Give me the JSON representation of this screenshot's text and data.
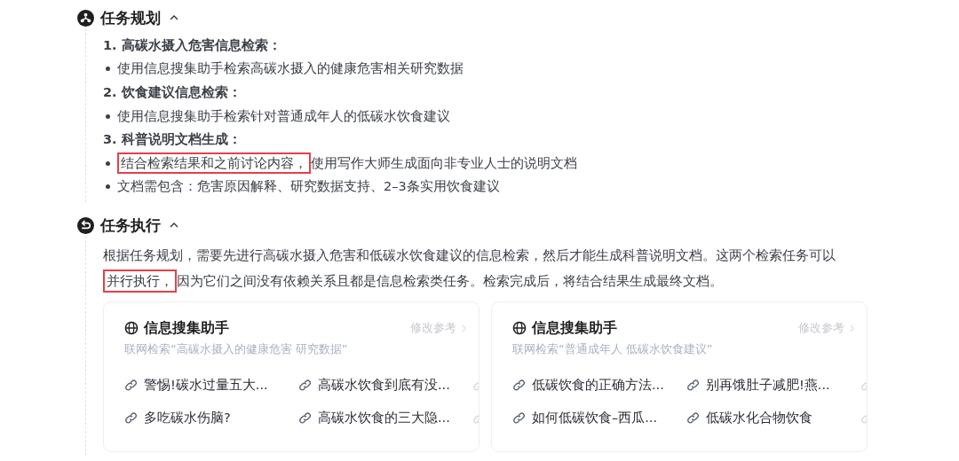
{
  "sections": [
    {
      "kind": "plan",
      "title": "任务规划",
      "expanded": true,
      "items": [
        {
          "kind": "heading",
          "segments": [
            {
              "text": "1. 高碳水摄入危害信息检索：",
              "highlighted": false
            }
          ]
        },
        {
          "kind": "bullet",
          "segments": [
            {
              "text": "使用信息搜集助手检索高碳水摄入的健康危害相关研究数据",
              "highlighted": false
            }
          ]
        },
        {
          "kind": "heading",
          "segments": [
            {
              "text": "2. 饮食建议信息检索：",
              "highlighted": false
            }
          ]
        },
        {
          "kind": "bullet",
          "segments": [
            {
              "text": "使用信息搜集助手检索针对普通成年人的低碳水饮食建议",
              "highlighted": false
            }
          ]
        },
        {
          "kind": "heading",
          "segments": [
            {
              "text": "3. 科普说明文档生成：",
              "highlighted": false
            }
          ]
        },
        {
          "kind": "bullet",
          "segments": [
            {
              "text": "结合检索结果和之前讨论内容，",
              "highlighted": true
            },
            {
              "text": "使用写作大师生成面向非专业人士的说明文档",
              "highlighted": false
            }
          ]
        },
        {
          "kind": "bullet",
          "segments": [
            {
              "text": "文档需包含：危害原因解释、研究数据支持、2–3条实用饮食建议",
              "highlighted": false
            }
          ]
        }
      ]
    },
    {
      "kind": "exec",
      "title": "任务执行",
      "expanded": true,
      "paragraph": [
        {
          "text": "根据任务规划，需要先进行高碳水摄入危害和低碳水饮食建议的信息检索，然后才能生成科普说明文档。这两个检索任务可以",
          "highlighted": false
        },
        {
          "text": "并行执行，",
          "highlighted": true
        },
        {
          "text": "因为它们之间没有依赖关系且都是信息检索类任务。检索完成后，将结合结果生成最终文档。",
          "highlighted": false
        }
      ],
      "cards": [
        {
          "title": "信息搜集助手",
          "action": "修改参考",
          "query": "联网检索“高碳水摄入的健康危害 研究数据”",
          "links": [
            "警惕!碳水过量五大...",
            "高碳水饮食到底有没...",
            "多吃碳水伤脑?",
            "高碳水饮食的三大隐..."
          ]
        },
        {
          "title": "信息搜集助手",
          "action": "修改参考",
          "query": "联网检索“普通成年人 低碳水饮食建议”",
          "links": [
            "低碳饮食的正确方法...",
            "别再饿肚子减肥!燕...",
            "如何低碳饮食–西瓜...",
            "低碳水化合物饮食"
          ]
        }
      ]
    }
  ]
}
